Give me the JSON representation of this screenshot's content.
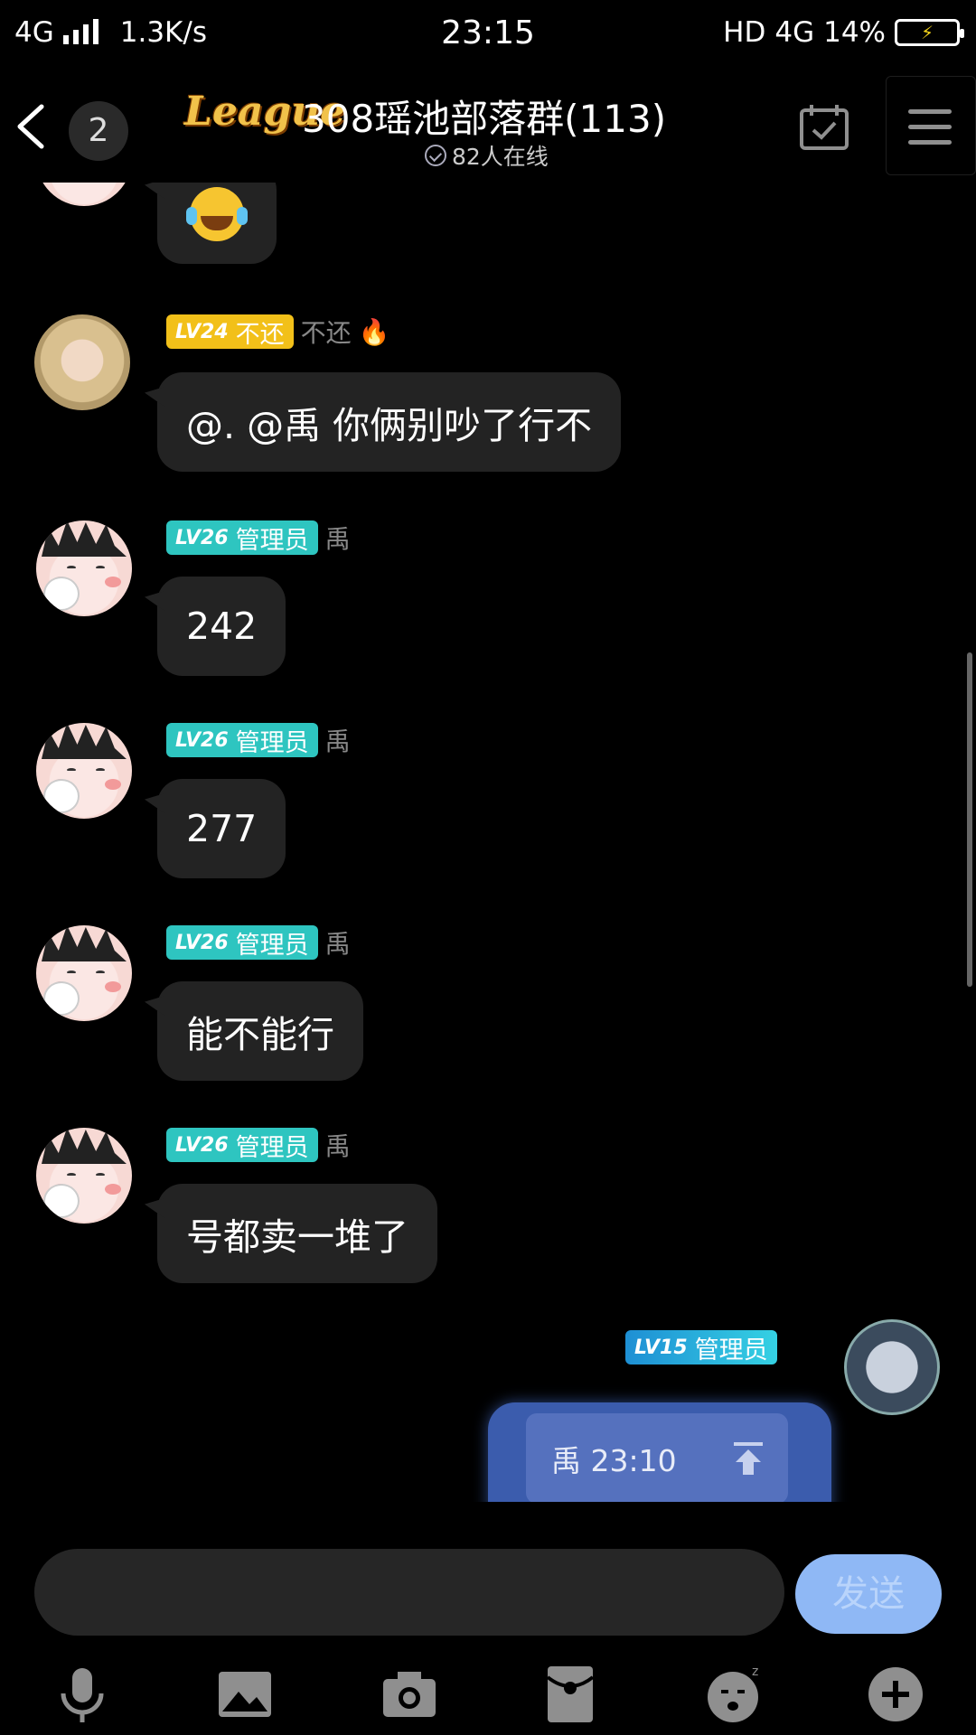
{
  "status_bar": {
    "network": "4G",
    "speed": "1.3K/s",
    "time": "23:15",
    "hd": "HD",
    "network_right": "4G",
    "battery": "14%"
  },
  "header": {
    "back_icon": "chevron-left-icon",
    "unread_count": "2",
    "logo_text": "League",
    "title": "308瑶池部落群(113)",
    "online": "82人在线",
    "calendar_icon": "calendar-check-icon",
    "menu_icon": "menu-icon"
  },
  "messages": [
    {
      "level": "LV24",
      "badge": "不还",
      "nick": "不还",
      "text": "@. @禹 你俩别吵了行不"
    },
    {
      "level": "LV26",
      "badge": "管理员",
      "nick": "禹",
      "text": "242"
    },
    {
      "level": "LV26",
      "badge": "管理员",
      "nick": "禹",
      "text": "277"
    },
    {
      "level": "LV26",
      "badge": "管理员",
      "nick": "禹",
      "text": "能不能行"
    },
    {
      "level": "LV26",
      "badge": "管理员",
      "nick": "禹",
      "text": "号都卖一堆了"
    }
  ],
  "my_message": {
    "level": "LV15",
    "badge": "管理员",
    "quote": "禹 23:10"
  },
  "input": {
    "placeholder": "",
    "send_label": "发送"
  },
  "toolbar": [
    "microphone-icon",
    "image-icon",
    "camera-icon",
    "red-packet-icon",
    "sticker-icon",
    "plus-icon"
  ],
  "colors": {
    "background": "#000000",
    "bubble": "#232323",
    "badge_admin": "#2ec5c0",
    "badge_member": "#f2c019",
    "send_button": "#8fb8f5",
    "my_bubble": "#3b5cad"
  }
}
